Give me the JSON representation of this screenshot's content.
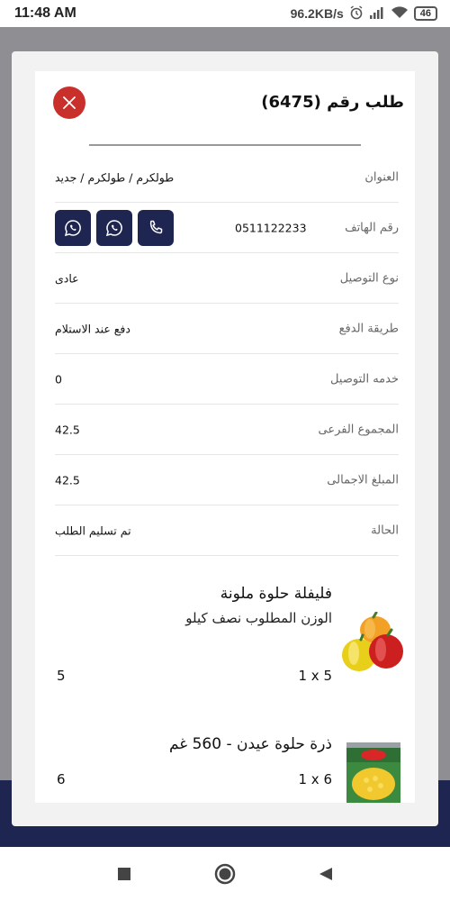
{
  "status_bar": {
    "time": "11:48 AM",
    "network_speed": "96.2KB/s",
    "battery_level": "46",
    "icons": [
      "alarm-icon",
      "signal-icon",
      "wifi-icon",
      "battery-icon"
    ]
  },
  "order": {
    "title": "طلب رقم (6475)",
    "fields": [
      {
        "label": "العنوان",
        "value": "طولكرم / طولكرم / جديد"
      },
      {
        "label": "رقم الهاتف",
        "value": "0511122233"
      },
      {
        "label": "نوع التوصيل",
        "value": "عادى"
      },
      {
        "label": "طريقة الدفع",
        "value": "دفع عند الاستلام"
      },
      {
        "label": "خدمه التوصيل",
        "value": "0"
      },
      {
        "label": "المجموع الفرعى",
        "value": "42.5"
      },
      {
        "label": "المبلغ الاجمالى",
        "value": "42.5"
      },
      {
        "label": "الحالة",
        "value": "تم تسليم الطلب"
      }
    ],
    "contact_buttons": [
      "phone-call",
      "whatsapp",
      "whatsapp"
    ]
  },
  "products": [
    {
      "name": "فليفلة حلوة ملونة",
      "subtitle": "الوزن المطلوب نصف كيلو",
      "multiplier": "1 x 5",
      "quantity": "5",
      "image": "bell-peppers"
    },
    {
      "name": "ذرة حلوة عيدن - 560 غم",
      "subtitle": "",
      "multiplier": "1 x 6",
      "quantity": "6",
      "image": "corn-can"
    }
  ],
  "colors": {
    "primary_navy": "#1e2550",
    "close_red": "#c9302c",
    "backdrop_gray": "#8e8e93"
  }
}
